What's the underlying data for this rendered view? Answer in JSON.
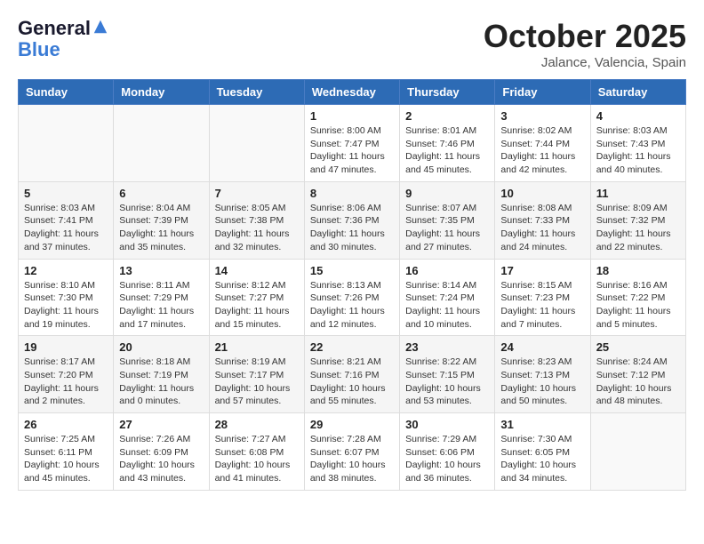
{
  "header": {
    "logo_line1": "General",
    "logo_line2": "Blue",
    "month": "October 2025",
    "location": "Jalance, Valencia, Spain"
  },
  "weekdays": [
    "Sunday",
    "Monday",
    "Tuesday",
    "Wednesday",
    "Thursday",
    "Friday",
    "Saturday"
  ],
  "weeks": [
    [
      {
        "day": "",
        "info": ""
      },
      {
        "day": "",
        "info": ""
      },
      {
        "day": "",
        "info": ""
      },
      {
        "day": "1",
        "info": "Sunrise: 8:00 AM\nSunset: 7:47 PM\nDaylight: 11 hours\nand 47 minutes."
      },
      {
        "day": "2",
        "info": "Sunrise: 8:01 AM\nSunset: 7:46 PM\nDaylight: 11 hours\nand 45 minutes."
      },
      {
        "day": "3",
        "info": "Sunrise: 8:02 AM\nSunset: 7:44 PM\nDaylight: 11 hours\nand 42 minutes."
      },
      {
        "day": "4",
        "info": "Sunrise: 8:03 AM\nSunset: 7:43 PM\nDaylight: 11 hours\nand 40 minutes."
      }
    ],
    [
      {
        "day": "5",
        "info": "Sunrise: 8:03 AM\nSunset: 7:41 PM\nDaylight: 11 hours\nand 37 minutes."
      },
      {
        "day": "6",
        "info": "Sunrise: 8:04 AM\nSunset: 7:39 PM\nDaylight: 11 hours\nand 35 minutes."
      },
      {
        "day": "7",
        "info": "Sunrise: 8:05 AM\nSunset: 7:38 PM\nDaylight: 11 hours\nand 32 minutes."
      },
      {
        "day": "8",
        "info": "Sunrise: 8:06 AM\nSunset: 7:36 PM\nDaylight: 11 hours\nand 30 minutes."
      },
      {
        "day": "9",
        "info": "Sunrise: 8:07 AM\nSunset: 7:35 PM\nDaylight: 11 hours\nand 27 minutes."
      },
      {
        "day": "10",
        "info": "Sunrise: 8:08 AM\nSunset: 7:33 PM\nDaylight: 11 hours\nand 24 minutes."
      },
      {
        "day": "11",
        "info": "Sunrise: 8:09 AM\nSunset: 7:32 PM\nDaylight: 11 hours\nand 22 minutes."
      }
    ],
    [
      {
        "day": "12",
        "info": "Sunrise: 8:10 AM\nSunset: 7:30 PM\nDaylight: 11 hours\nand 19 minutes."
      },
      {
        "day": "13",
        "info": "Sunrise: 8:11 AM\nSunset: 7:29 PM\nDaylight: 11 hours\nand 17 minutes."
      },
      {
        "day": "14",
        "info": "Sunrise: 8:12 AM\nSunset: 7:27 PM\nDaylight: 11 hours\nand 15 minutes."
      },
      {
        "day": "15",
        "info": "Sunrise: 8:13 AM\nSunset: 7:26 PM\nDaylight: 11 hours\nand 12 minutes."
      },
      {
        "day": "16",
        "info": "Sunrise: 8:14 AM\nSunset: 7:24 PM\nDaylight: 11 hours\nand 10 minutes."
      },
      {
        "day": "17",
        "info": "Sunrise: 8:15 AM\nSunset: 7:23 PM\nDaylight: 11 hours\nand 7 minutes."
      },
      {
        "day": "18",
        "info": "Sunrise: 8:16 AM\nSunset: 7:22 PM\nDaylight: 11 hours\nand 5 minutes."
      }
    ],
    [
      {
        "day": "19",
        "info": "Sunrise: 8:17 AM\nSunset: 7:20 PM\nDaylight: 11 hours\nand 2 minutes."
      },
      {
        "day": "20",
        "info": "Sunrise: 8:18 AM\nSunset: 7:19 PM\nDaylight: 11 hours\nand 0 minutes."
      },
      {
        "day": "21",
        "info": "Sunrise: 8:19 AM\nSunset: 7:17 PM\nDaylight: 10 hours\nand 57 minutes."
      },
      {
        "day": "22",
        "info": "Sunrise: 8:21 AM\nSunset: 7:16 PM\nDaylight: 10 hours\nand 55 minutes."
      },
      {
        "day": "23",
        "info": "Sunrise: 8:22 AM\nSunset: 7:15 PM\nDaylight: 10 hours\nand 53 minutes."
      },
      {
        "day": "24",
        "info": "Sunrise: 8:23 AM\nSunset: 7:13 PM\nDaylight: 10 hours\nand 50 minutes."
      },
      {
        "day": "25",
        "info": "Sunrise: 8:24 AM\nSunset: 7:12 PM\nDaylight: 10 hours\nand 48 minutes."
      }
    ],
    [
      {
        "day": "26",
        "info": "Sunrise: 7:25 AM\nSunset: 6:11 PM\nDaylight: 10 hours\nand 45 minutes."
      },
      {
        "day": "27",
        "info": "Sunrise: 7:26 AM\nSunset: 6:09 PM\nDaylight: 10 hours\nand 43 minutes."
      },
      {
        "day": "28",
        "info": "Sunrise: 7:27 AM\nSunset: 6:08 PM\nDaylight: 10 hours\nand 41 minutes."
      },
      {
        "day": "29",
        "info": "Sunrise: 7:28 AM\nSunset: 6:07 PM\nDaylight: 10 hours\nand 38 minutes."
      },
      {
        "day": "30",
        "info": "Sunrise: 7:29 AM\nSunset: 6:06 PM\nDaylight: 10 hours\nand 36 minutes."
      },
      {
        "day": "31",
        "info": "Sunrise: 7:30 AM\nSunset: 6:05 PM\nDaylight: 10 hours\nand 34 minutes."
      },
      {
        "day": "",
        "info": ""
      }
    ]
  ]
}
